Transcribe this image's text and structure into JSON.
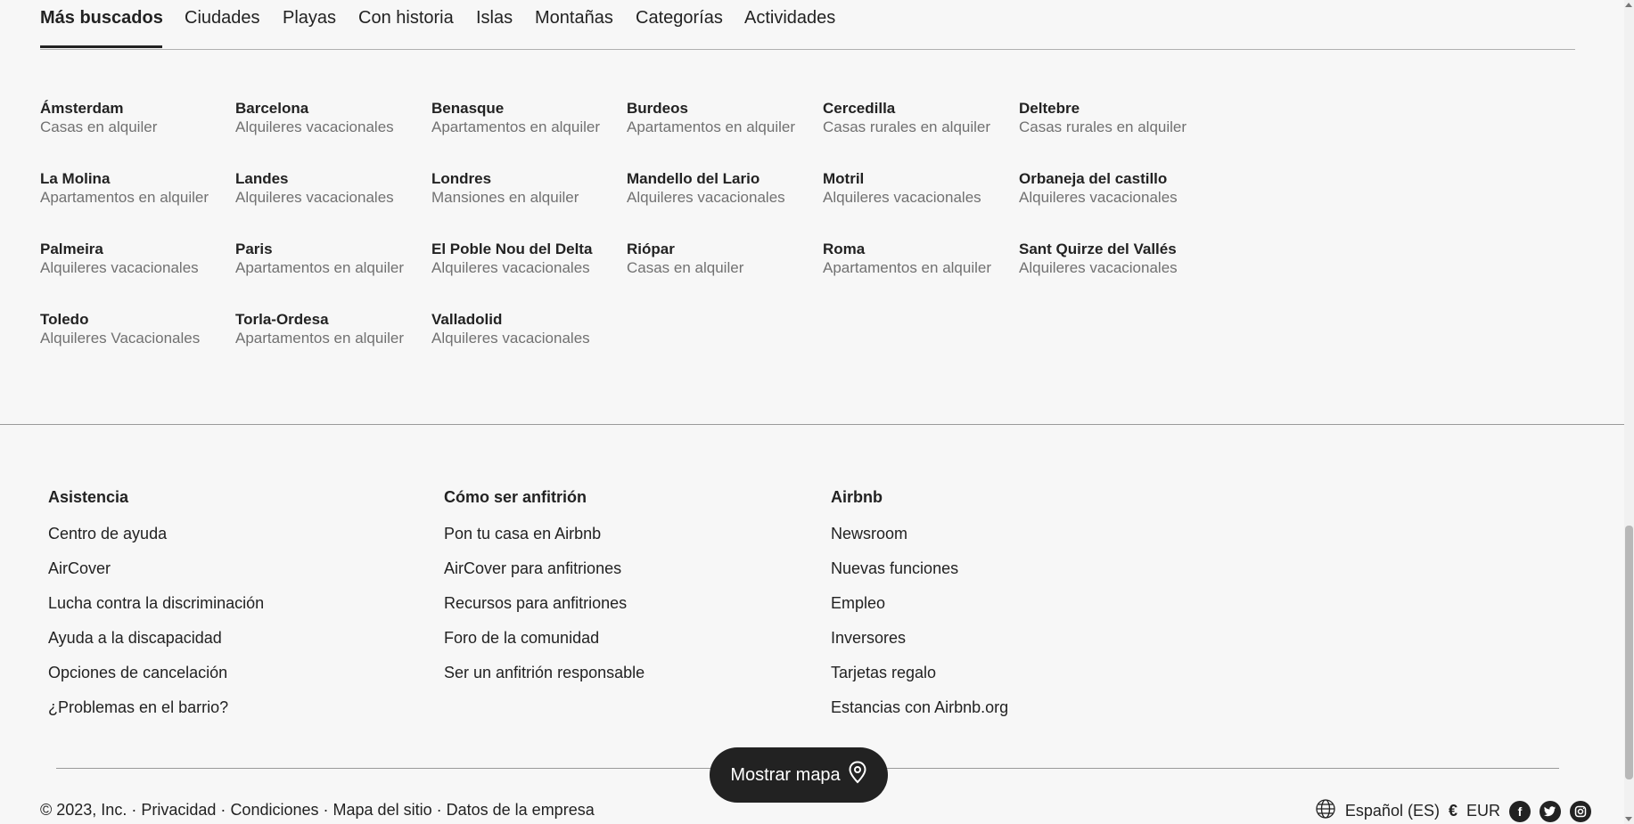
{
  "tabs": [
    "Más buscados",
    "Ciudades",
    "Playas",
    "Con historia",
    "Islas",
    "Montañas",
    "Categorías",
    "Actividades"
  ],
  "destinations": [
    {
      "city": "Ámsterdam",
      "type": "Casas en alquiler"
    },
    {
      "city": "Barcelona",
      "type": "Alquileres vacacionales"
    },
    {
      "city": "Benasque",
      "type": "Apartamentos en alquiler"
    },
    {
      "city": "Burdeos",
      "type": "Apartamentos en alquiler"
    },
    {
      "city": "Cercedilla",
      "type": "Casas rurales en alquiler"
    },
    {
      "city": "Deltebre",
      "type": "Casas rurales en alquiler"
    },
    {
      "city": "La Molina",
      "type": "Apartamentos en alquiler"
    },
    {
      "city": "Landes",
      "type": "Alquileres vacacionales"
    },
    {
      "city": "Londres",
      "type": "Mansiones en alquiler"
    },
    {
      "city": "Mandello del Lario",
      "type": "Alquileres vacacionales"
    },
    {
      "city": "Motril",
      "type": "Alquileres vacacionales"
    },
    {
      "city": "Orbaneja del castillo",
      "type": "Alquileres vacacionales"
    },
    {
      "city": "Palmeira",
      "type": "Alquileres vacacionales"
    },
    {
      "city": "Paris",
      "type": "Apartamentos en alquiler"
    },
    {
      "city": "El Poble Nou del Delta",
      "type": "Alquileres vacacionales"
    },
    {
      "city": "Riópar",
      "type": "Casas en alquiler"
    },
    {
      "city": "Roma",
      "type": "Apartamentos en alquiler"
    },
    {
      "city": "Sant Quirze del Vallés",
      "type": "Alquileres vacacionales"
    },
    {
      "city": "Toledo",
      "type": "Alquileres Vacacionales"
    },
    {
      "city": "Torla-Ordesa",
      "type": "Apartamentos en alquiler"
    },
    {
      "city": "Valladolid",
      "type": "Alquileres vacacionales"
    }
  ],
  "footer": {
    "columns": [
      {
        "heading": "Asistencia",
        "links": [
          "Centro de ayuda",
          "AirCover",
          "Lucha contra la discriminación",
          "Ayuda a la discapacidad",
          "Opciones de cancelación",
          "¿Problemas en el barrio?"
        ]
      },
      {
        "heading": "Cómo ser anfitrión",
        "links": [
          "Pon tu casa en Airbnb",
          "AirCover para anfitriones",
          "Recursos para anfitriones",
          "Foro de la comunidad",
          "Ser un anfitrión responsable"
        ]
      },
      {
        "heading": "Airbnb",
        "links": [
          "Newsroom",
          "Nuevas funciones",
          "Empleo",
          "Inversores",
          "Tarjetas regalo",
          "Estancias con Airbnb.org"
        ]
      }
    ],
    "copyright": "© 2023, Inc.",
    "separator": "·",
    "legal_links": [
      "Privacidad",
      "Condiciones",
      "Mapa del sitio",
      "Datos de la empresa"
    ],
    "language": "Español (ES)",
    "currency_symbol": "€",
    "currency": "EUR",
    "social_icons": [
      "facebook-icon",
      "twitter-icon",
      "instagram-icon"
    ]
  },
  "map_button": {
    "label": "Mostrar mapa"
  }
}
